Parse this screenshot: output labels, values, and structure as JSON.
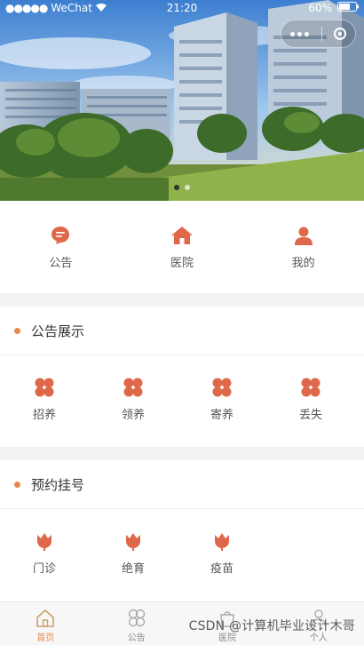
{
  "status_bar": {
    "carrier": "WeChat",
    "time": "21:20",
    "battery": "60%"
  },
  "top_nav": [
    {
      "label": "公告",
      "icon": "chat-bubble-icon"
    },
    {
      "label": "医院",
      "icon": "home-icon"
    },
    {
      "label": "我的",
      "icon": "user-icon"
    }
  ],
  "announcements": {
    "title": "公告展示",
    "items": [
      {
        "label": "招养",
        "icon": "four-dots-icon"
      },
      {
        "label": "领养",
        "icon": "four-dots-icon"
      },
      {
        "label": "寄养",
        "icon": "four-dots-icon"
      },
      {
        "label": "丢失",
        "icon": "four-dots-icon"
      }
    ]
  },
  "appointments": {
    "title": "预约挂号",
    "items": [
      {
        "label": "门诊",
        "icon": "tulip-icon"
      },
      {
        "label": "绝育",
        "icon": "tulip-icon"
      },
      {
        "label": "疫苗",
        "icon": "tulip-icon"
      }
    ]
  },
  "tabbar": [
    {
      "label": "首页",
      "icon": "home-outline-icon"
    },
    {
      "label": "公告",
      "icon": "flower-outline-icon"
    },
    {
      "label": "医院",
      "icon": "bag-outline-icon"
    },
    {
      "label": "个人",
      "icon": "person-outline-icon"
    }
  ],
  "watermark": "CSDN @计算机毕业设计木哥",
  "colors": {
    "accent": "#e0684a",
    "dot": "#e8894a"
  }
}
